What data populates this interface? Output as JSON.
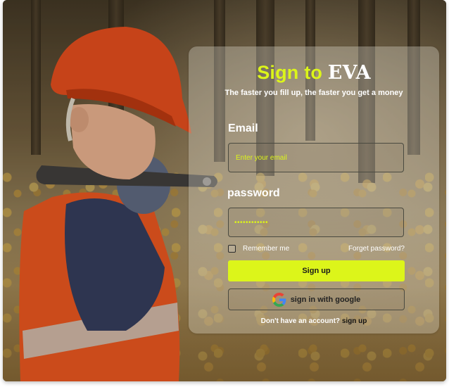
{
  "colors": {
    "accent": "#dcf51a",
    "text_light": "#ffffff",
    "text_dark": "#1a1a1a"
  },
  "header": {
    "title_prefix": "Sign to",
    "title_brand": "EVA",
    "subtitle": "The faster you fill up, the faster you get a money"
  },
  "form": {
    "email_label": "Email",
    "email_placeholder": "Enter your email",
    "password_label": "password",
    "password_value": "••••••••••••",
    "remember_label": "Remember me",
    "forgot_label": "Forget password?",
    "signup_button": "Sign up",
    "google_button": "sign in with google",
    "google_icon": "google-icon"
  },
  "footer": {
    "prompt": "Don't have an account?",
    "link": "sign up"
  }
}
